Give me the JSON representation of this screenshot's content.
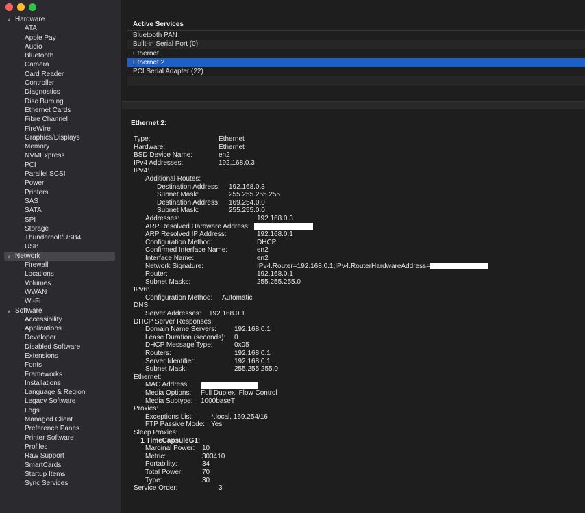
{
  "window": {
    "traffic_lights": [
      "#ff5f57",
      "#febc2e",
      "#28c840"
    ]
  },
  "sidebar": {
    "categories": [
      {
        "label": "Hardware",
        "items": [
          "ATA",
          "Apple Pay",
          "Audio",
          "Bluetooth",
          "Camera",
          "Card Reader",
          "Controller",
          "Diagnostics",
          "Disc Burning",
          "Ethernet Cards",
          "Fibre Channel",
          "FireWire",
          "Graphics/Displays",
          "Memory",
          "NVMExpress",
          "PCI",
          "Parallel SCSI",
          "Power",
          "Printers",
          "SAS",
          "SATA",
          "SPI",
          "Storage",
          "Thunderbolt/USB4",
          "USB"
        ]
      },
      {
        "label": "Network",
        "selected": true,
        "items": [
          "Firewall",
          "Locations",
          "Volumes",
          "WWAN",
          "Wi-Fi"
        ]
      },
      {
        "label": "Software",
        "items": [
          "Accessibility",
          "Applications",
          "Developer",
          "Disabled Software",
          "Extensions",
          "Fonts",
          "Frameworks",
          "Installations",
          "Language & Region",
          "Legacy Software",
          "Logs",
          "Managed Client",
          "Preference Panes",
          "Printer Software",
          "Profiles",
          "Raw Support",
          "SmartCards",
          "Startup Items",
          "Sync Services"
        ]
      }
    ]
  },
  "services": {
    "header": "Active Services",
    "rows": [
      "Bluetooth PAN",
      "Built-in Serial Port (0)",
      "Ethernet",
      "Ethernet 2",
      "PCI Serial Adapter (22)"
    ],
    "selected_index": 3,
    "selected_color": "#1c5fc7"
  },
  "detail": {
    "title": "Ethernet 2:",
    "lines": [
      {
        "k": "Type:",
        "v": "Ethernet",
        "indent": 0,
        "vx": 124
      },
      {
        "k": "Hardware:",
        "v": "Ethernet",
        "indent": 0,
        "vx": 124
      },
      {
        "k": "BSD Device Name:",
        "v": "en2",
        "indent": 0,
        "vx": 124
      },
      {
        "k": "IPv4 Addresses:",
        "v": "192.168.0.3",
        "indent": 0,
        "vx": 124
      },
      {
        "k": "IPv4:",
        "v": "",
        "indent": 0
      },
      {
        "k": "Additional Routes:",
        "v": "",
        "indent": 1
      },
      {
        "k": "Destination Address:",
        "v": "192.168.0.3",
        "indent": 2,
        "vx": 139
      },
      {
        "k": "Subnet Mask:",
        "v": "255.255.255.255",
        "indent": 2,
        "vx": 139
      },
      {
        "k": "Destination Address:",
        "v": "169.254.0.0",
        "indent": 2,
        "vx": 139
      },
      {
        "k": "Subnet Mask:",
        "v": "255.255.0.0",
        "indent": 2,
        "vx": 139
      },
      {
        "k": "Addresses:",
        "v": "192.168.0.3",
        "indent": 1,
        "vx": 180
      },
      {
        "k": "ARP Resolved Hardware Address:",
        "v": "",
        "indent": 1,
        "vx": 176,
        "redact": 86
      },
      {
        "k": "ARP Resolved IP Address:",
        "v": "192.168.0.1",
        "indent": 1,
        "vx": 180
      },
      {
        "k": "Configuration Method:",
        "v": "DHCP",
        "indent": 1,
        "vx": 180
      },
      {
        "k": "Confirmed Interface Name:",
        "v": "en2",
        "indent": 1,
        "vx": 180
      },
      {
        "k": "Interface Name:",
        "v": "en2",
        "indent": 1,
        "vx": 180
      },
      {
        "k": "Network Signature:",
        "v": "IPv4.Router=192.168.0.1;IPv4.RouterHardwareAddress=",
        "indent": 1,
        "vx": 180,
        "redact": 84
      },
      {
        "k": "Router:",
        "v": "192.168.0.1",
        "indent": 1,
        "vx": 180
      },
      {
        "k": "Subnet Masks:",
        "v": "255.255.255.0",
        "indent": 1,
        "vx": 180
      },
      {
        "k": "IPv6:",
        "v": "",
        "indent": 0
      },
      {
        "k": "Configuration Method:",
        "v": "Automatic",
        "indent": 1,
        "vx": 129
      },
      {
        "k": "DNS:",
        "v": "",
        "indent": 0
      },
      {
        "k": "Server Addresses:",
        "v": "192.168.0.1",
        "indent": 1,
        "vx": 110
      },
      {
        "k": "DHCP Server Responses:",
        "v": "",
        "indent": 0
      },
      {
        "k": "Domain Name Servers:",
        "v": "192.168.0.1",
        "indent": 1,
        "vx": 147
      },
      {
        "k": "Lease Duration (seconds):",
        "v": "0",
        "indent": 1,
        "vx": 147
      },
      {
        "k": "DHCP Message Type:",
        "v": "0x05",
        "indent": 1,
        "vx": 147
      },
      {
        "k": "Routers:",
        "v": "192.168.0.1",
        "indent": 1,
        "vx": 147
      },
      {
        "k": "Server Identifier:",
        "v": "192.168.0.1",
        "indent": 1,
        "vx": 147
      },
      {
        "k": "Subnet Mask:",
        "v": "255.255.255.0",
        "indent": 1,
        "vx": 147
      },
      {
        "k": "Ethernet:",
        "v": "",
        "indent": 0
      },
      {
        "k": "MAC Address:",
        "v": "",
        "indent": 1,
        "vx": 98,
        "redact": 84
      },
      {
        "k": "Media Options:",
        "v": "Full Duplex, Flow Control",
        "indent": 1,
        "vx": 98
      },
      {
        "k": "Media Subtype:",
        "v": "1000baseT",
        "indent": 1,
        "vx": 98
      },
      {
        "k": "Proxies:",
        "v": "",
        "indent": 0
      },
      {
        "k": "Exceptions List:",
        "v": "*.local, 169.254/16",
        "indent": 1,
        "vx": 113
      },
      {
        "k": "FTP Passive Mode:",
        "v": "Yes",
        "indent": 1,
        "vx": 113
      },
      {
        "k": "Sleep Proxies:",
        "v": "",
        "indent": 0
      },
      {
        "k": "1 TimeCapsuleG1:",
        "v": "",
        "indent": 0.6,
        "bold": true
      },
      {
        "k": "Marginal Power:",
        "v": "10",
        "indent": 1,
        "vx": 100
      },
      {
        "k": "Metric:",
        "v": "303410",
        "indent": 1,
        "vx": 100
      },
      {
        "k": "Portability:",
        "v": "34",
        "indent": 1,
        "vx": 100
      },
      {
        "k": "Total Power:",
        "v": "70",
        "indent": 1,
        "vx": 100
      },
      {
        "k": "Type:",
        "v": "30",
        "indent": 1,
        "vx": 100
      },
      {
        "k": "Service Order:",
        "v": "3",
        "indent": 0,
        "vx": 124
      }
    ]
  }
}
